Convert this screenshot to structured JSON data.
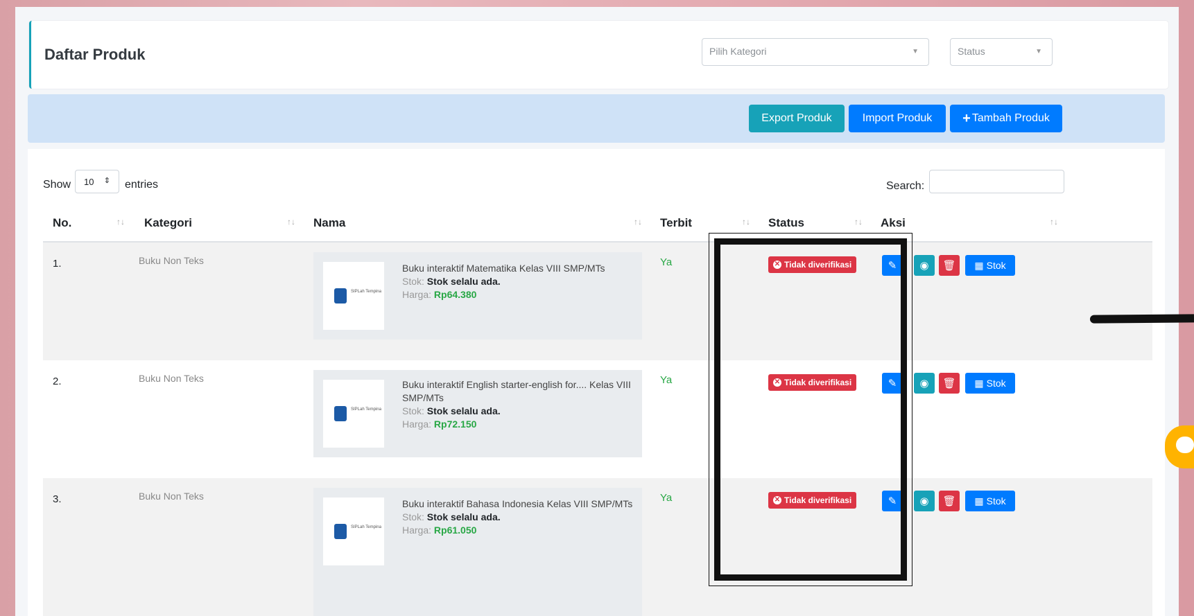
{
  "page_title": "Daftar Produk",
  "filters": {
    "kategori_placeholder": "Pilih Kategori",
    "status_placeholder": "Status"
  },
  "actions": {
    "export": "Export Produk",
    "import": "Import Produk",
    "add": "Tambah Produk"
  },
  "table_controls": {
    "show": "Show",
    "length_value": "10",
    "entries": "entries",
    "search_label": "Search:"
  },
  "columns": [
    "No.",
    "Kategori",
    "Nama",
    "Terbit",
    "Status",
    "Aksi"
  ],
  "labels": {
    "stok_prefix": "Stok:",
    "harga_prefix": "Harga:",
    "stok_button": "Stok",
    "logo_text": "SIPLah Tempina"
  },
  "rows": [
    {
      "no": "1.",
      "kategori": "Buku Non Teks",
      "name": "Buku interaktif Matematika Kelas VIII SMP/MTs",
      "stok": "Stok selalu ada.",
      "harga": "Rp64.380",
      "terbit": "Ya",
      "status": "Tidak diverifikasi"
    },
    {
      "no": "2.",
      "kategori": "Buku Non Teks",
      "name": "Buku interaktif English starter-english for.... Kelas VIII SMP/MTs",
      "stok": "Stok selalu ada.",
      "harga": "Rp72.150",
      "terbit": "Ya",
      "status": "Tidak diverifikasi"
    },
    {
      "no": "3.",
      "kategori": "Buku Non Teks",
      "name": "Buku interaktif Bahasa Indonesia Kelas VIII SMP/MTs",
      "stok": "Stok selalu ada.",
      "harga": "Rp61.050",
      "terbit": "Ya",
      "status": "Tidak diverifikasi"
    }
  ],
  "colors": {
    "primary": "#007bff",
    "info": "#17a2b8",
    "danger": "#dc3545",
    "success": "#28a745",
    "chat": "#ffb300"
  },
  "icons": [
    "edit-icon",
    "eye-icon",
    "trash-icon",
    "stock-icon",
    "x-circle-icon",
    "plus-icon",
    "chat-icon",
    "sort-icon"
  ]
}
